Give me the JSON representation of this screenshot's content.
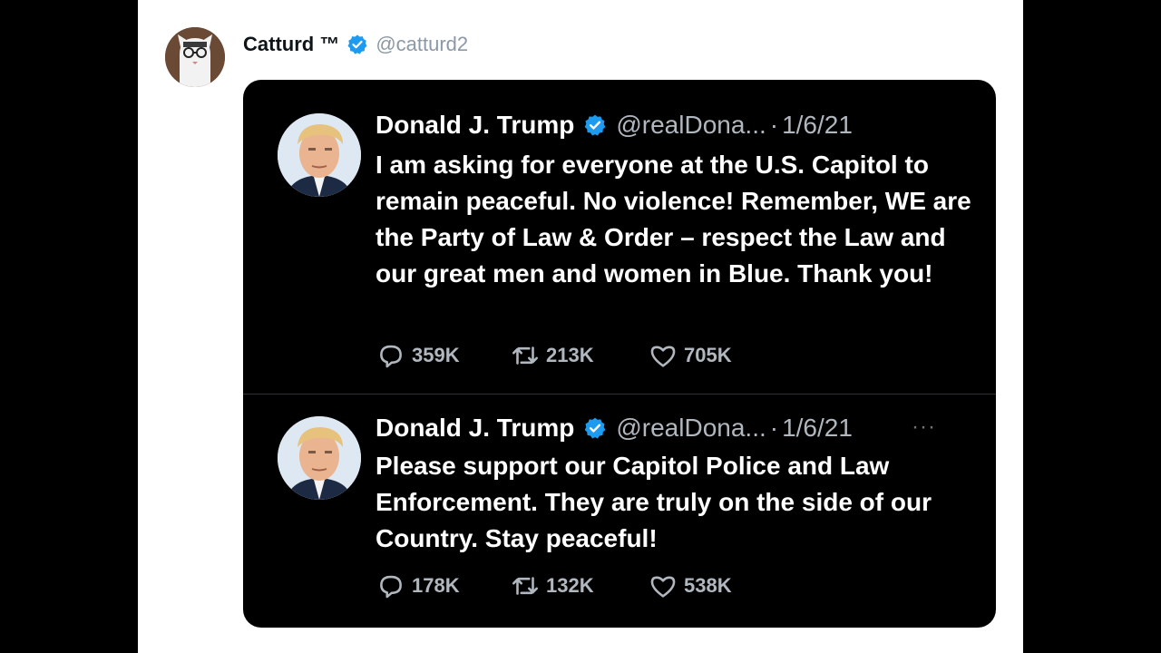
{
  "outer": {
    "name": "Catturd ™",
    "handle": "@catturd2"
  },
  "embed": {
    "tweets": [
      {
        "name": "Donald J. Trump",
        "handle": "@realDona...",
        "separator": "·",
        "date": "1/6/21",
        "text": "I am asking for everyone at the U.S. Capitol to remain peaceful. No violence! Remember, WE are the Party of Law & Order – respect the Law and our great men and women in Blue. Thank you!",
        "replies": "359K",
        "retweets": "213K",
        "likes": "705K"
      },
      {
        "name": "Donald J. Trump",
        "handle": "@realDona...",
        "separator": "·",
        "date": "1/6/21",
        "more": "···",
        "text": "Please support our Capitol Police and Law Enforcement. They are truly on the side of our Country. Stay peaceful!",
        "replies": "178K",
        "retweets": "132K",
        "likes": "538K"
      }
    ]
  },
  "colors": {
    "verified": "#1d9bf0",
    "embed_bg": "#000000",
    "muted_text": "#8b98a5"
  },
  "icons": [
    "verified-badge-icon",
    "reply-icon",
    "retweet-icon",
    "like-icon",
    "more-icon"
  ]
}
